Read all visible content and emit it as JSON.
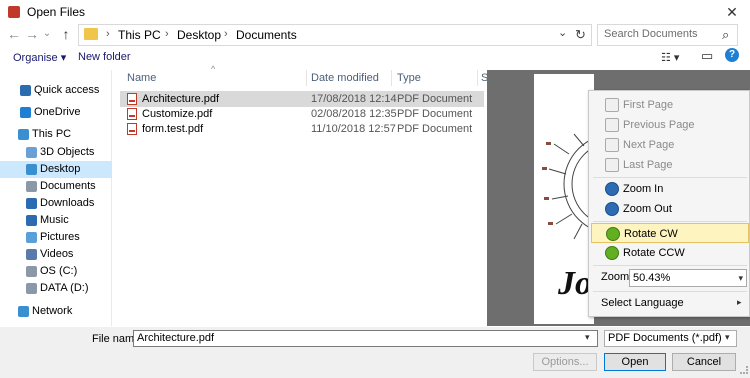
{
  "window": {
    "title": "Open Files",
    "close_glyph": "✕"
  },
  "nav": {
    "back_glyph": "←",
    "forward_glyph": "→",
    "up_glyph": "↑",
    "history_glyph": "⌄",
    "refresh_glyph": "↻"
  },
  "breadcrumb": {
    "items": [
      "This PC",
      "Desktop",
      "Documents"
    ],
    "separator": "›",
    "dropdown_glyph": "⌄"
  },
  "search": {
    "placeholder": "Search Documents",
    "icon_glyph": "⌕"
  },
  "toolbar": {
    "organise_label": "Organise ▾",
    "new_folder_label": "New folder",
    "view_glyph": "☷ ▾",
    "pane_glyph": "▭",
    "help_glyph": "?"
  },
  "sidebar": {
    "items": [
      {
        "label": "Quick access",
        "icon": "star-icon",
        "color": "#2b6cb0"
      },
      {
        "label": "OneDrive",
        "icon": "cloud-icon",
        "color": "#1e7fd4"
      },
      {
        "label": "This PC",
        "icon": "computer-icon",
        "color": "#3a8fd1"
      },
      {
        "label": "3D Objects",
        "icon": "cube-icon",
        "color": "#6aa0d8"
      },
      {
        "label": "Desktop",
        "icon": "desktop-icon",
        "color": "#3a8fd1"
      },
      {
        "label": "Documents",
        "icon": "documents-icon",
        "color": "#8a98a8"
      },
      {
        "label": "Downloads",
        "icon": "download-icon",
        "color": "#2b6cb0"
      },
      {
        "label": "Music",
        "icon": "music-icon",
        "color": "#2b6cb0"
      },
      {
        "label": "Pictures",
        "icon": "pictures-icon",
        "color": "#5aa0d8"
      },
      {
        "label": "Videos",
        "icon": "videos-icon",
        "color": "#5a7aa8"
      },
      {
        "label": "OS (C:)",
        "icon": "drive-icon",
        "color": "#8a98a8"
      },
      {
        "label": "DATA (D:)",
        "icon": "drive-icon",
        "color": "#8a98a8"
      },
      {
        "label": "Network",
        "icon": "network-icon",
        "color": "#3a8fd1"
      }
    ],
    "selected": "Desktop"
  },
  "file_list": {
    "sort_glyph": "^",
    "columns": [
      "Name",
      "Date modified",
      "Type",
      "S"
    ],
    "rows": [
      {
        "name": "Architecture.pdf",
        "date": "17/08/2018 12:14",
        "type": "PDF Document"
      },
      {
        "name": "Customize.pdf",
        "date": "02/08/2018 12:35",
        "type": "PDF Document"
      },
      {
        "name": "form.test.pdf",
        "date": "11/10/2018 12:57",
        "type": "PDF Document"
      }
    ]
  },
  "preview_text": "Jo",
  "context_menu": {
    "items": [
      {
        "label": "First Page",
        "state": "disabled"
      },
      {
        "label": "Previous Page",
        "state": "disabled"
      },
      {
        "label": "Next Page",
        "state": "disabled"
      },
      {
        "label": "Last Page",
        "state": "disabled"
      },
      {
        "label": "Zoom In",
        "state": "enabled"
      },
      {
        "label": "Zoom Out",
        "state": "enabled"
      },
      {
        "label": "Rotate CW",
        "state": "highlighted"
      },
      {
        "label": "Rotate CCW",
        "state": "enabled"
      }
    ],
    "zoom_label": "Zoom:",
    "zoom_value": "50.43%",
    "select_language_label": "Select Language",
    "arrow_glyph": "▾",
    "submenu_glyph": "▸"
  },
  "footer": {
    "file_name_label": "File name:",
    "file_name_value": "Architecture.pdf",
    "file_type_value": "PDF Documents (*.pdf)",
    "options_label": "Options...",
    "open_label": "Open",
    "cancel_label": "Cancel"
  }
}
